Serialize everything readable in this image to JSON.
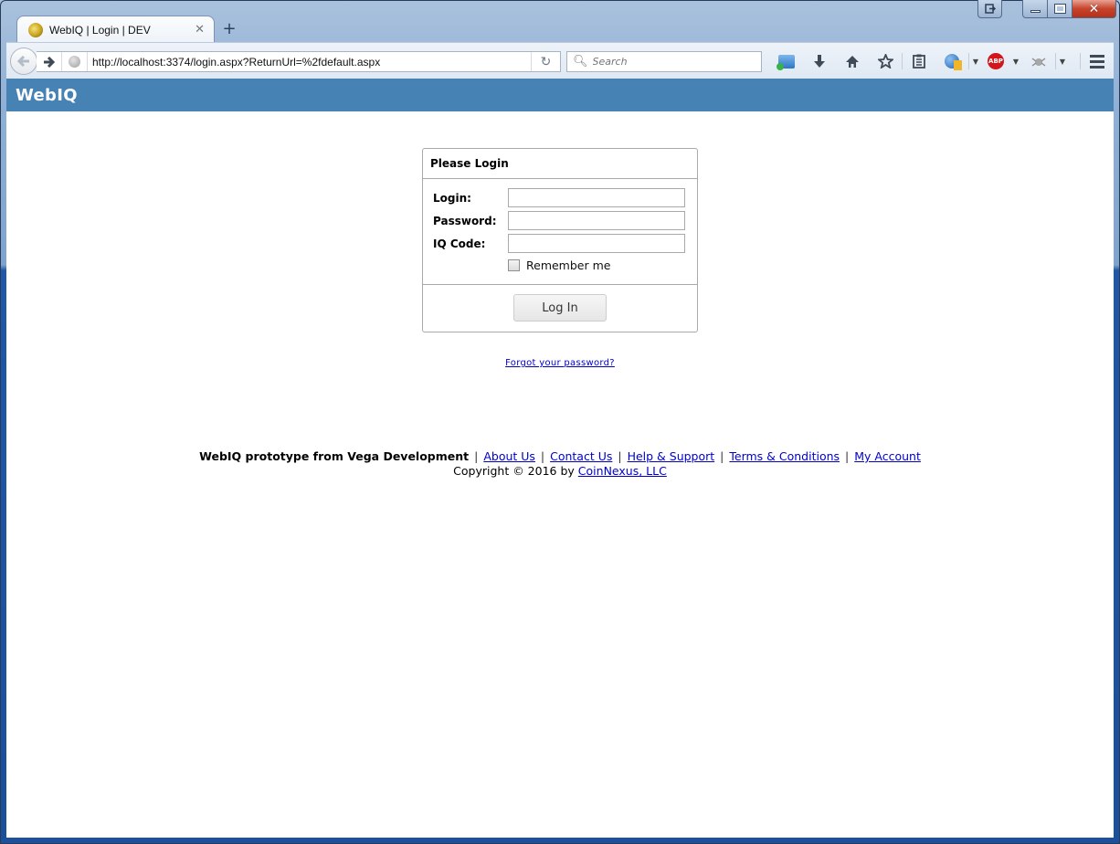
{
  "browser": {
    "tab": {
      "title": "WebIQ | Login | DEV",
      "close_glyph": "✕"
    },
    "new_tab_glyph": "+",
    "url": "http://localhost:3374/login.aspx?ReturnUrl=%2fdefault.aspx",
    "search_placeholder": "Search",
    "toolbar_icons": [
      "folder-sync-icon",
      "download-icon",
      "home-icon",
      "bookmark-star-icon",
      "reading-list-icon",
      "addon-icon",
      "adblock-plus-icon",
      "bug-icon",
      "menu-icon"
    ],
    "adblock_label": "ABP"
  },
  "site": {
    "title": "WebIQ",
    "header_color": "#4682b4"
  },
  "login": {
    "heading": "Please Login",
    "fields": [
      {
        "label": "Login:",
        "value": ""
      },
      {
        "label": "Password:",
        "value": ""
      },
      {
        "label": "IQ Code:",
        "value": ""
      }
    ],
    "remember_label": "Remember me",
    "remember_checked": false,
    "submit_label": "Log In",
    "forgot_link": "Forgot your password?"
  },
  "footer": {
    "brand": "WebIQ prototype from Vega Development",
    "separator": "|",
    "links": [
      "About Us",
      "Contact Us",
      "Help & Support",
      "Terms & Conditions",
      "My Account"
    ],
    "copyright_prefix": "Copyright © 2016 by",
    "company_link": "CoinNexus, LLC",
    "link_color": "#0000cc"
  }
}
